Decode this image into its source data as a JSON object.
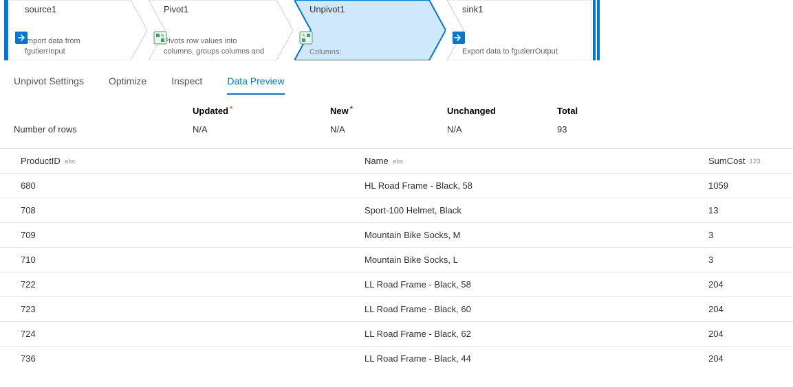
{
  "pipeline": {
    "nodes": [
      {
        "title": "source1",
        "subtitle": "Import data from fgutierrInput",
        "kind": "source"
      },
      {
        "title": "Pivot1",
        "subtitle": "Pivots row values into columns, groups columns and",
        "kind": "pivot"
      },
      {
        "title": "Unpivot1",
        "subtitle_label": "Columns:",
        "kind": "unpivot",
        "selected": true
      },
      {
        "title": "sink1",
        "subtitle": "Export data to fgutierrOutput",
        "kind": "sink"
      }
    ]
  },
  "tabs": {
    "items": [
      "Unpivot Settings",
      "Optimize",
      "Inspect",
      "Data Preview"
    ],
    "active_index": 3
  },
  "stats": {
    "row_label": "Number of rows",
    "columns": [
      {
        "header": "Updated",
        "marker": "orange",
        "value": "N/A"
      },
      {
        "header": "New",
        "marker": "green",
        "value": "N/A"
      },
      {
        "header": "Unchanged",
        "marker": "",
        "value": "N/A"
      },
      {
        "header": "Total",
        "marker": "",
        "value": "93"
      }
    ]
  },
  "table": {
    "columns": [
      {
        "name": "ProductID",
        "type": "abc"
      },
      {
        "name": "Name",
        "type": "abc"
      },
      {
        "name": "SumCost",
        "type": "123"
      }
    ],
    "rows": [
      {
        "ProductID": "680",
        "Name": "HL Road Frame - Black, 58",
        "SumCost": "1059"
      },
      {
        "ProductID": "708",
        "Name": "Sport-100 Helmet, Black",
        "SumCost": "13"
      },
      {
        "ProductID": "709",
        "Name": "Mountain Bike Socks, M",
        "SumCost": "3"
      },
      {
        "ProductID": "710",
        "Name": "Mountain Bike Socks, L",
        "SumCost": "3"
      },
      {
        "ProductID": "722",
        "Name": "LL Road Frame - Black, 58",
        "SumCost": "204"
      },
      {
        "ProductID": "723",
        "Name": "LL Road Frame - Black, 60",
        "SumCost": "204"
      },
      {
        "ProductID": "724",
        "Name": "LL Road Frame - Black, 62",
        "SumCost": "204"
      },
      {
        "ProductID": "736",
        "Name": "LL Road Frame - Black, 44",
        "SumCost": "204"
      }
    ]
  }
}
